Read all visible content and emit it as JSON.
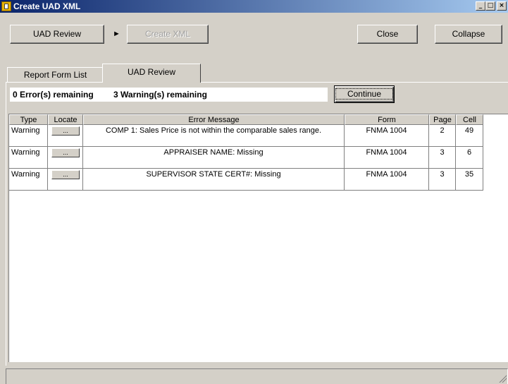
{
  "window": {
    "title": "Create UAD XML",
    "controls": {
      "minimize": "_",
      "maximize": "□",
      "close": "×"
    }
  },
  "toolbar": {
    "uad_review_label": "UAD Review",
    "arrow": "►",
    "create_xml_label": "Create XML",
    "close_label": "Close",
    "collapse_label": "Collapse"
  },
  "tabs": [
    {
      "label": "Report Form List",
      "active": false
    },
    {
      "label": "UAD Review",
      "active": true
    }
  ],
  "status": {
    "errors": "0 Error(s) remaining",
    "warnings": "3 Warning(s) remaining"
  },
  "continue_label": "Continue",
  "grid": {
    "columns": [
      "Type",
      "Locate",
      "Error Message",
      "Form",
      "Page",
      "Cell"
    ],
    "rows": [
      {
        "type": "Warning",
        "locate": "...",
        "message": "COMP 1: Sales Price is not within the comparable sales range.",
        "form": "FNMA 1004",
        "page": "2",
        "cell": "49"
      },
      {
        "type": "Warning",
        "locate": "...",
        "message": "APPRAISER NAME: Missing",
        "form": "FNMA 1004",
        "page": "3",
        "cell": "6"
      },
      {
        "type": "Warning",
        "locate": "...",
        "message": "SUPERVISOR STATE CERT#: Missing",
        "form": "FNMA 1004",
        "page": "3",
        "cell": "35"
      }
    ]
  }
}
